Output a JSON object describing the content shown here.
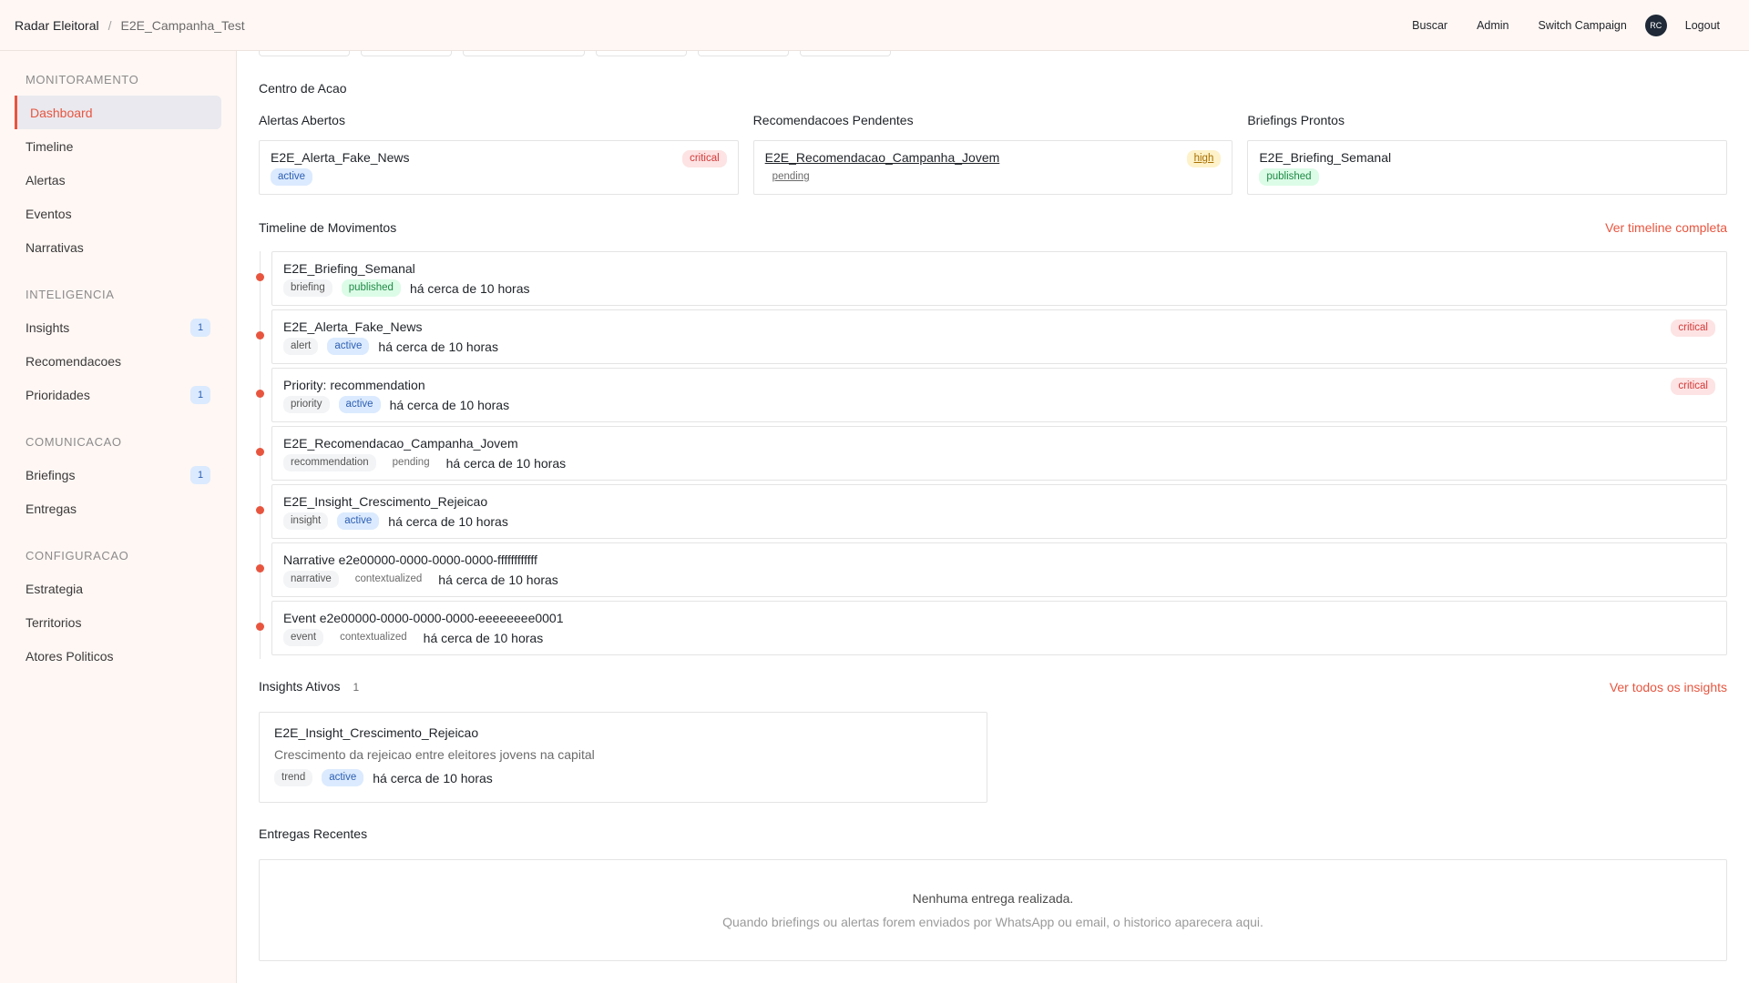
{
  "header": {
    "app_name": "Radar Eleitoral",
    "separator": "/",
    "campaign": "E2E_Campanha_Test",
    "nav": [
      {
        "label": "Buscar"
      },
      {
        "label": "Admin"
      },
      {
        "label": "Switch Campaign"
      }
    ],
    "avatar": "RC",
    "logout": "Logout"
  },
  "sidebar": {
    "sections": [
      {
        "title": "MONITORAMENTO",
        "items": [
          {
            "label": "Dashboard",
            "active": true
          },
          {
            "label": "Timeline"
          },
          {
            "label": "Alertas"
          },
          {
            "label": "Eventos"
          },
          {
            "label": "Narrativas"
          }
        ]
      },
      {
        "title": "INTELIGENCIA",
        "items": [
          {
            "label": "Insights",
            "badge": "1"
          },
          {
            "label": "Recomendacoes"
          },
          {
            "label": "Prioridades",
            "badge": "1"
          }
        ]
      },
      {
        "title": "COMUNICACAO",
        "items": [
          {
            "label": "Briefings",
            "badge": "1"
          },
          {
            "label": "Entregas"
          }
        ]
      },
      {
        "title": "CONFIGURACAO",
        "items": [
          {
            "label": "Estrategia"
          },
          {
            "label": "Territorios"
          },
          {
            "label": "Atores Politicos"
          }
        ]
      }
    ]
  },
  "action_center": {
    "title": "Centro de Acao",
    "columns": [
      {
        "heading": "Alertas Abertos",
        "card": {
          "title": "E2E_Alerta_Fake_News",
          "status": "active",
          "severity": "critical"
        }
      },
      {
        "heading": "Recomendacoes Pendentes",
        "card": {
          "title": "E2E_Recomendacao_Campanha_Jovem",
          "status": "pending",
          "severity": "high"
        }
      },
      {
        "heading": "Briefings Prontos",
        "card": {
          "title": "E2E_Briefing_Semanal",
          "status": "published"
        }
      }
    ]
  },
  "timeline": {
    "title": "Timeline de Movimentos",
    "link": "Ver timeline completa",
    "items": [
      {
        "title": "E2E_Briefing_Semanal",
        "kind": "briefing",
        "status": "published",
        "time": "há cerca de 10 horas"
      },
      {
        "title": "E2E_Alerta_Fake_News",
        "kind": "alert",
        "status": "active",
        "time": "há cerca de 10 horas",
        "severity": "critical"
      },
      {
        "title": "Priority: recommendation",
        "kind": "priority",
        "status": "active",
        "time": "há cerca de 10 horas",
        "severity": "critical"
      },
      {
        "title": "E2E_Recomendacao_Campanha_Jovem",
        "kind": "recommendation",
        "status": "pending",
        "time": "há cerca de 10 horas"
      },
      {
        "title": "E2E_Insight_Crescimento_Rejeicao",
        "kind": "insight",
        "status": "active",
        "time": "há cerca de 10 horas"
      },
      {
        "title": "Narrative e2e00000-0000-0000-0000-ffffffffffff",
        "kind": "narrative",
        "status": "contextualized",
        "time": "há cerca de 10 horas"
      },
      {
        "title": "Event e2e00000-0000-0000-0000-eeeeeeee0001",
        "kind": "event",
        "status": "contextualized",
        "time": "há cerca de 10 horas"
      }
    ]
  },
  "insights": {
    "title": "Insights Ativos",
    "count": "1",
    "link": "Ver todos os insights",
    "card": {
      "title": "E2E_Insight_Crescimento_Rejeicao",
      "description": "Crescimento da rejeicao entre eleitores jovens na capital",
      "kind": "trend",
      "status": "active",
      "time": "há cerca de 10 horas"
    }
  },
  "deliveries": {
    "title": "Entregas Recentes",
    "empty_title": "Nenhuma entrega realizada.",
    "empty_desc": "Quando briefings ou alertas forem enviados por WhatsApp ou email, o historico aparecera aqui."
  },
  "colors": {
    "accent": "#e8553f",
    "critical": "#d33a3a",
    "active": "#2d5fb3",
    "published": "#1f8a45",
    "high": "#a86f00"
  }
}
